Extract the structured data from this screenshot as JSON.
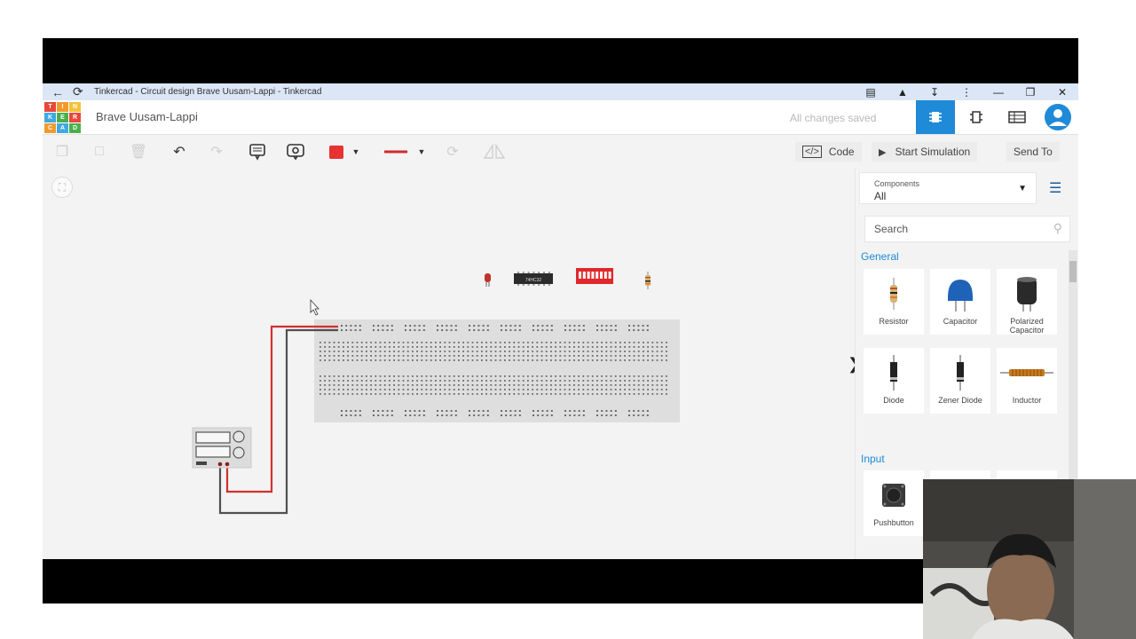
{
  "window": {
    "title": "Tinkercad - Circuit design Brave Uusam-Lappi - Tinkercad",
    "icons": [
      "back-arrow-icon",
      "reload-icon",
      "translate-icon",
      "extensions-icon",
      "download-icon",
      "more-icon",
      "minimize-icon",
      "restore-icon",
      "close-icon"
    ]
  },
  "header": {
    "logo_letters": [
      "T",
      "I",
      "N",
      "K",
      "E",
      "R",
      "C",
      "A",
      "D"
    ],
    "logo_colors": [
      "#e8473b",
      "#f09a2e",
      "#f2c23a",
      "#3fa9e0",
      "#4ab04a",
      "#e8473b",
      "#f09a2e",
      "#3fa9e0",
      "#4ab04a"
    ],
    "design_name": "Brave Uusam-Lappi",
    "save_status": "All changes saved",
    "accent": "#1e8ad8"
  },
  "toolbar": {
    "code_label": "Code",
    "start_simulation_label": "Start Simulation",
    "send_to_label": "Send To",
    "fill_color": "#e63232",
    "wire_color": "#d22b2b"
  },
  "panel": {
    "components_label": "Components",
    "components_value": "All",
    "search_placeholder": "Search",
    "sections": [
      {
        "title": "General",
        "items": [
          "Resistor",
          "Capacitor",
          "Polarized Capacitor",
          "Diode",
          "Zener Diode",
          "Inductor"
        ]
      },
      {
        "title": "Input",
        "items": [
          "Pushbutton"
        ]
      }
    ]
  },
  "canvas": {
    "ic_label": "74HC32"
  }
}
